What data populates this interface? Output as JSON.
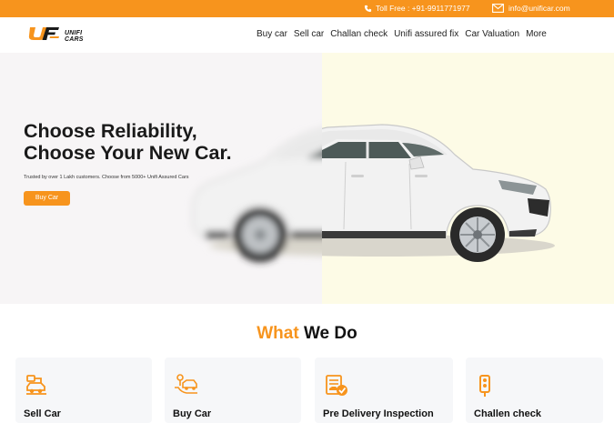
{
  "topbar": {
    "toll_free": "Toll Free : +91-9911771977",
    "email": "info@unificar.com",
    "phone_icon": "phone-icon",
    "mail_icon": "mail-icon"
  },
  "header": {
    "logo_line1": "UNIFI",
    "logo_line2": "CARS",
    "nav": [
      "Buy car",
      "Sell car",
      "Challan check",
      "Unifi assured fix",
      "Car Valuation",
      "More"
    ]
  },
  "hero": {
    "title_line1": "Choose Reliability,",
    "title_line2": "Choose Your New Car.",
    "subtitle": "Trusted by over 1 Lakh customers.   Choose from 5000+ Unifi Assured Cars",
    "cta": "Buy Car"
  },
  "what_we_do": {
    "title_accent": "What",
    "title_rest": " We Do",
    "cards": [
      {
        "label": "Sell Car",
        "icon": "sell-car-icon"
      },
      {
        "label": "Buy Car",
        "icon": "buy-car-icon"
      },
      {
        "label": "Pre Delivery Inspection",
        "icon": "inspection-icon"
      },
      {
        "label": "Challen check",
        "icon": "challan-icon"
      }
    ]
  },
  "colors": {
    "accent": "#f7941d",
    "hero_left_bg": "#f7f5f6",
    "hero_right_bg": "#fdfbe6"
  }
}
